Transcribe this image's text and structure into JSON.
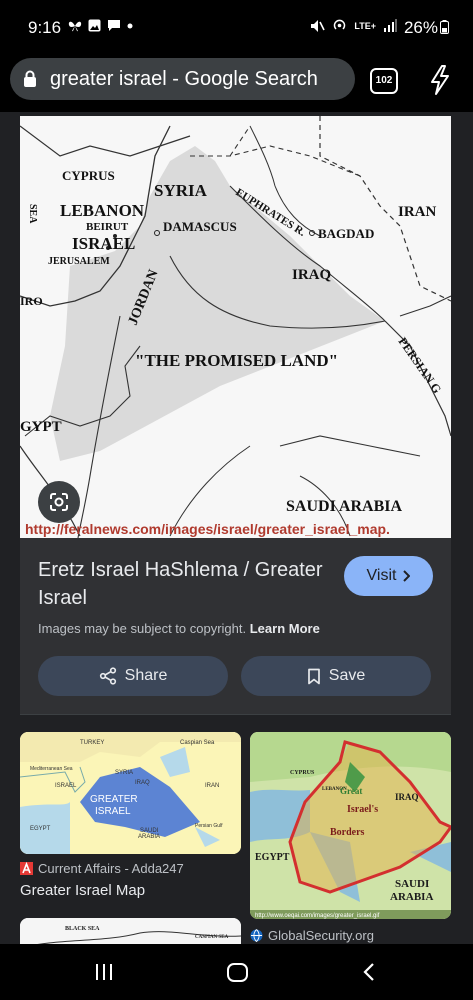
{
  "status": {
    "time": "9:16",
    "network": "LTE+",
    "battery": "26%"
  },
  "browser": {
    "url_text": "greater israel - Google Search",
    "tab_count": "102"
  },
  "main_image": {
    "map_labels": {
      "cyprus": "CYPRUS",
      "lebanon": "LEBANON",
      "beirut": "BEIRUT",
      "israel": "ISRAEL",
      "jerusalem": "JERUSALEM",
      "syria": "SYRIA",
      "damascus": "DAMASCUS",
      "euphrates": "EUPHRATES R.",
      "bagdad": "BAGDAD",
      "iran": "IRAN",
      "iraq": "IRAQ",
      "jordan": "JORDAN",
      "promised_land": "\"THE PROMISED LAND\"",
      "persian": "PERSIAN G",
      "egypt": "GYPT",
      "cairo": "IRO",
      "saudi": "SAUDI ARABIA",
      "sea": "SEA",
      "source_url": "http://feralnews.com/images/israel/greater_israel_map."
    }
  },
  "result": {
    "title": "Eretz Israel HaShlema / Greater Israel",
    "visit_label": "Visit",
    "copyright_text": "Images may be subject to copyright.",
    "learn_more": "Learn More",
    "share_label": "Share",
    "save_label": "Save"
  },
  "related": [
    {
      "source": "Current Affairs - Adda247",
      "title": "Greater Israel Map",
      "map_labels": {
        "turkey": "TURKEY",
        "caspian": "Caspian Sea",
        "med": "Mediterranean Sea",
        "syria": "SYRIA",
        "israel": "ISRAEL",
        "iraq": "IRAQ",
        "iran": "IRAN",
        "greater": "GREATER",
        "israel2": "ISRAEL",
        "egypt": "EGYPT",
        "saudi": "SAUDI",
        "arabia": "ARABIA",
        "gulf": "Persian Gulf"
      }
    },
    {
      "source": "GlobalSecurity.org",
      "title": "",
      "map_labels": {
        "israels": "Israel's",
        "borders": "Borders",
        "egypt": "EGYPT",
        "saudi": "SAUDI",
        "arabia": "ARABIA",
        "iraq": "IRAQ",
        "cyprus": "CYPRUS",
        "lebanon": "LEBANON",
        "greater": "Great",
        "url": "http://www.oeqai.com/images/greater_israel.gif"
      }
    },
    {
      "source": "",
      "title": "",
      "map_labels": {
        "black_sea": "BLACK SEA",
        "caspian": "CASPIAN SEA"
      }
    }
  ]
}
